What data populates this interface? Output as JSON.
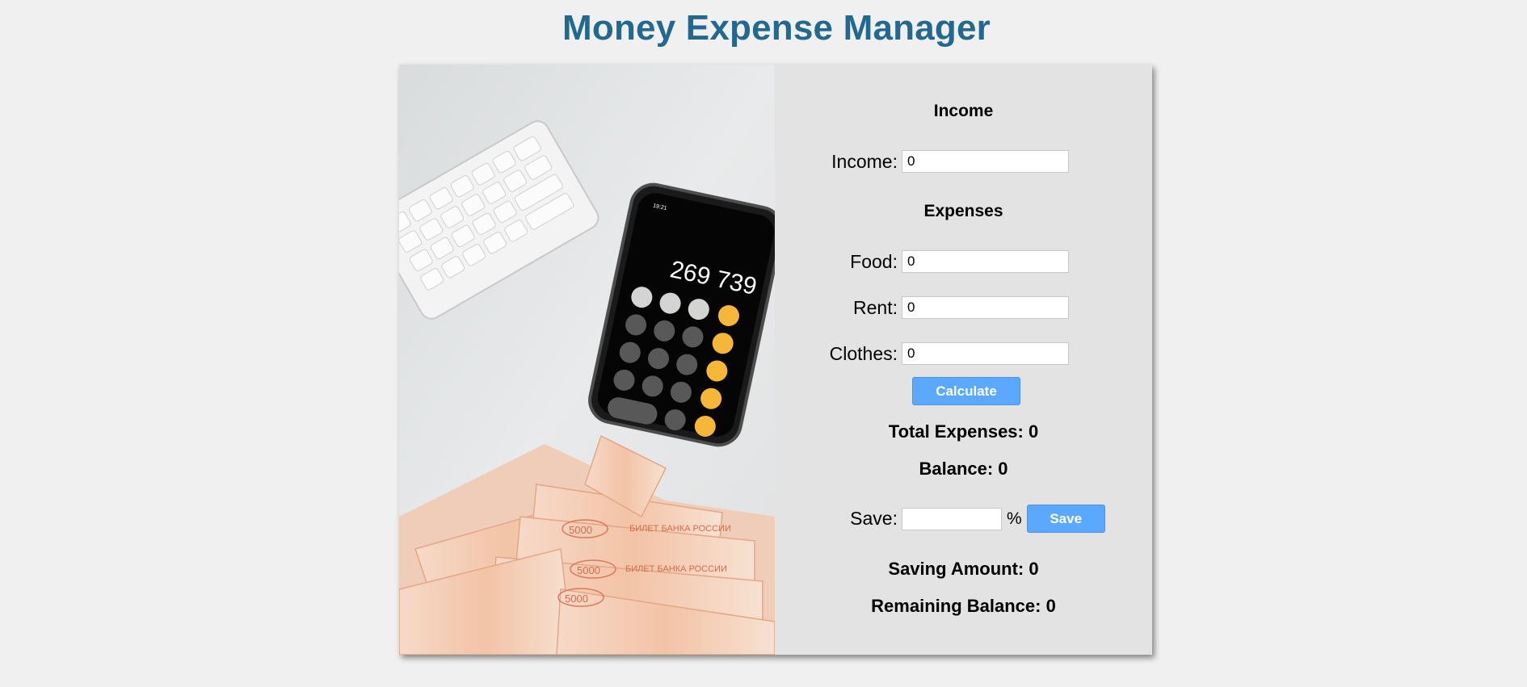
{
  "app": {
    "title": "Money Expense Manager"
  },
  "income": {
    "heading": "Income",
    "label": "Income:",
    "value": "0"
  },
  "expenses": {
    "heading": "Expenses",
    "food": {
      "label": "Food:",
      "value": "0"
    },
    "rent": {
      "label": "Rent:",
      "value": "0"
    },
    "clothes": {
      "label": "Clothes:",
      "value": "0"
    }
  },
  "calculate_button": "Calculate",
  "results": {
    "total_expenses": "Total Expenses: 0",
    "balance": "Balance: 0",
    "saving_amount": "Saving Amount: 0",
    "remaining_balance": "Remaining Balance: 0"
  },
  "save": {
    "label": "Save:",
    "value": "",
    "unit": "%",
    "button": "Save"
  },
  "photo": {
    "phone_display": "269 739",
    "phone_status_time": "19:21",
    "banknote_denomination": "5000",
    "banknote_text": "БИЛЕТ БАНКА РОССИИ"
  },
  "colors": {
    "title": "#23698f",
    "button": "#5aa8ff",
    "panel": "#e3e3e3",
    "background": "#f0f0f0"
  }
}
